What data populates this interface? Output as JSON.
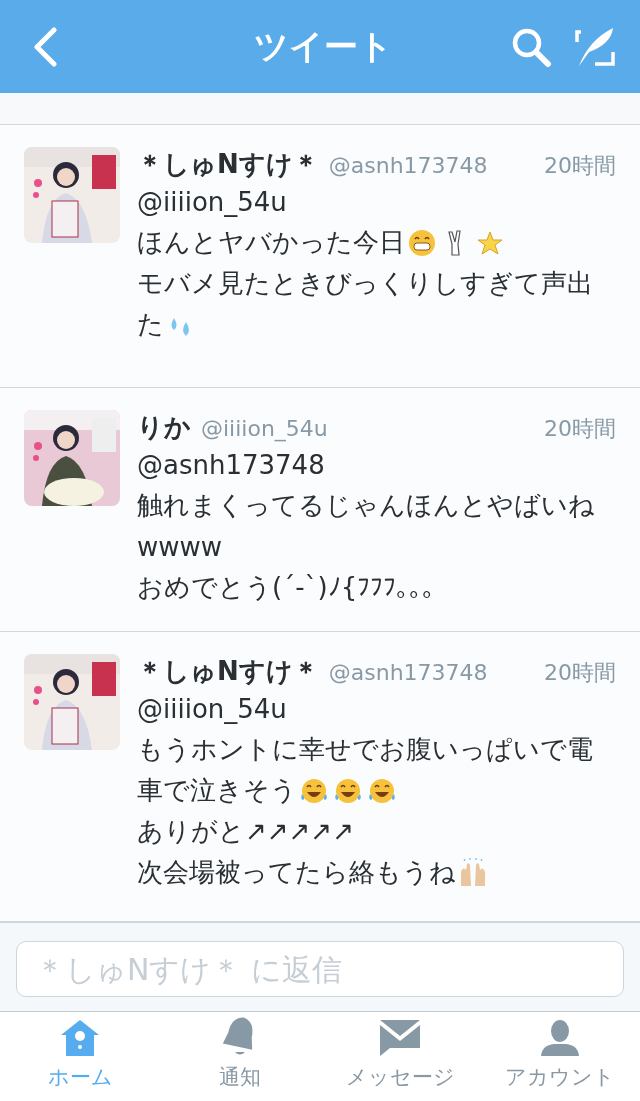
{
  "header": {
    "title": "ツイート"
  },
  "tweets": [
    {
      "name": "＊しゅNすけ＊",
      "handle": "@asnh173748",
      "time": "20時間",
      "avatar": {
        "kind": "picture"
      },
      "lines": [
        [
          {
            "kind": "text",
            "text": "@iiiion_54u"
          }
        ],
        [
          {
            "kind": "text",
            "text": "ほんとヤバかった今日"
          },
          {
            "kind": "grin"
          },
          {
            "kind": "peace"
          },
          {
            "kind": "star"
          }
        ],
        [
          {
            "kind": "text",
            "text": "モバメ見たときびっくりしすぎて声出"
          }
        ],
        [
          {
            "kind": "text",
            "text": "た"
          },
          {
            "kind": "sweat"
          }
        ]
      ]
    },
    {
      "name": "りか",
      "handle": "@iiiion_54u",
      "time": "20時間",
      "avatar": {
        "kind": "picture"
      },
      "lines": [
        [
          {
            "kind": "text",
            "text": "@asnh173748"
          }
        ],
        [
          {
            "kind": "text",
            "text": "触れまくってるじゃんほんとやばいね"
          }
        ],
        [
          {
            "kind": "text",
            "text": "wwww"
          }
        ],
        [
          {
            "kind": "text",
            "text": "おめでとう(´-`)ﾉ{ﾌﾌﾌ｡｡｡"
          }
        ]
      ]
    },
    {
      "name": "＊しゅNすけ＊",
      "handle": "@asnh173748",
      "time": "20時間",
      "avatar": {
        "kind": "picture"
      },
      "lines": [
        [
          {
            "kind": "text",
            "text": "@iiiion_54u"
          }
        ],
        [
          {
            "kind": "text",
            "text": "もうホントに幸せでお腹いっぱいで電"
          }
        ],
        [
          {
            "kind": "text",
            "text": "車で泣きそう"
          },
          {
            "kind": "laugh"
          },
          {
            "kind": "laugh"
          },
          {
            "kind": "laugh"
          }
        ],
        [
          {
            "kind": "text",
            "text": "ありがと↗︎↗︎↗︎↗︎↗︎"
          }
        ],
        [
          {
            "kind": "text",
            "text": "次会場被ってたら絡もうね"
          },
          {
            "kind": "hands"
          }
        ]
      ]
    }
  ],
  "reply": {
    "placeholder": "＊しゅNすけ＊ に返信"
  },
  "tabs": [
    {
      "kind": "home",
      "label": "ホーム",
      "selected": true
    },
    {
      "kind": "bell",
      "label": "通知",
      "selected": false
    },
    {
      "kind": "mail",
      "label": "メッセージ",
      "selected": false
    },
    {
      "kind": "person",
      "label": "アカウント",
      "selected": false
    }
  ]
}
